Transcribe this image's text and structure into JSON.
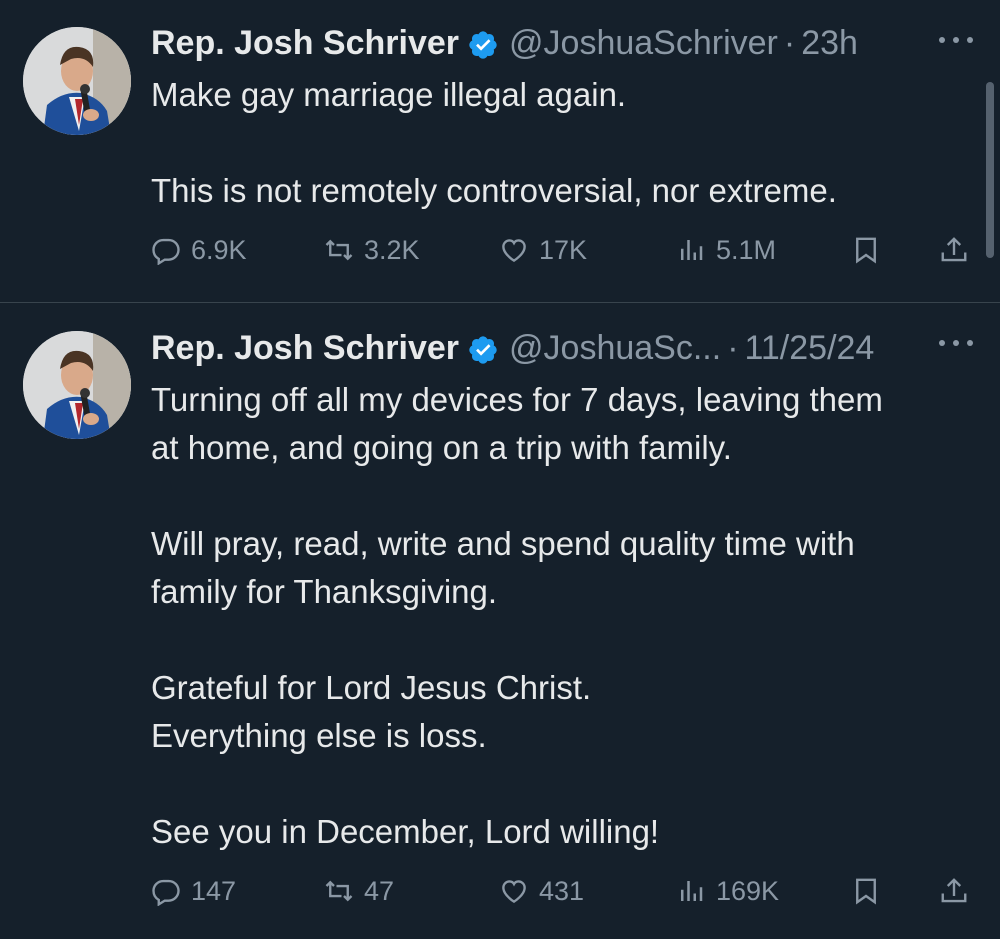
{
  "tweets": [
    {
      "name": "Rep. Josh Schriver",
      "handle": "@JoshuaSchriver",
      "separator": "·",
      "time": "23h",
      "text": "Make gay marriage illegal again.\n\nThis is not remotely controversial, nor extreme.",
      "stats": {
        "replies": "6.9K",
        "retweets": "3.2K",
        "likes": "17K",
        "views": "5.1M"
      }
    },
    {
      "name": "Rep. Josh Schriver",
      "handle": "@JoshuaSc...",
      "separator": "·",
      "time": "11/25/24",
      "text": "Turning off all my devices for 7 days, leaving them\nat home, and going on a trip with family.\n\nWill pray, read, write and spend quality time with\nfamily for Thanksgiving.\n\nGrateful for Lord Jesus Christ.\nEverything else is loss.\n\nSee you in December, Lord willing!",
      "stats": {
        "replies": "147",
        "retweets": "47",
        "likes": "431",
        "views": "169K"
      }
    }
  ],
  "icons": {
    "verified": "verified-badge-icon",
    "more": "more-dots-icon",
    "reply": "reply-icon",
    "retweet": "retweet-icon",
    "like": "heart-icon",
    "views": "views-chart-icon",
    "bookmark": "bookmark-icon",
    "share": "share-icon"
  },
  "colors": {
    "background": "#15202b",
    "text": "#e7e9ea",
    "muted": "#8b98a5",
    "verified": "#1d9bf0",
    "divider": "#38444d"
  }
}
